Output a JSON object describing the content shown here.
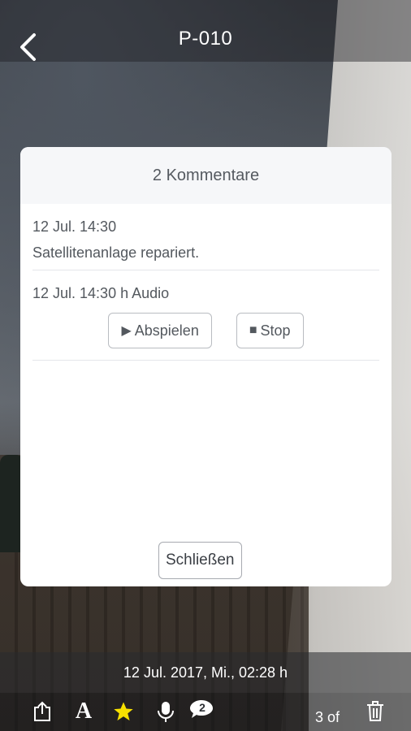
{
  "header": {
    "title": "P-010",
    "back_icon": "chevron-left-icon"
  },
  "modal": {
    "title": "2 Kommentare",
    "comments": [
      {
        "meta": "12 Jul. 14:30",
        "text": "Satellitenanlage repariert."
      },
      {
        "meta": "12 Jul. 14:30 h Audio",
        "play_label": "Abspielen",
        "stop_label": "Stop"
      }
    ],
    "close_label": "Schließen"
  },
  "footer": {
    "datetime": "12 Jul. 2017, Mi., 02:28 h",
    "counter": "3 of",
    "comment_badge": "2",
    "tools": [
      "share-icon",
      "text-icon",
      "star-icon",
      "microphone-icon",
      "comment-icon",
      "trash-icon"
    ],
    "star_color": "#f7e000"
  }
}
